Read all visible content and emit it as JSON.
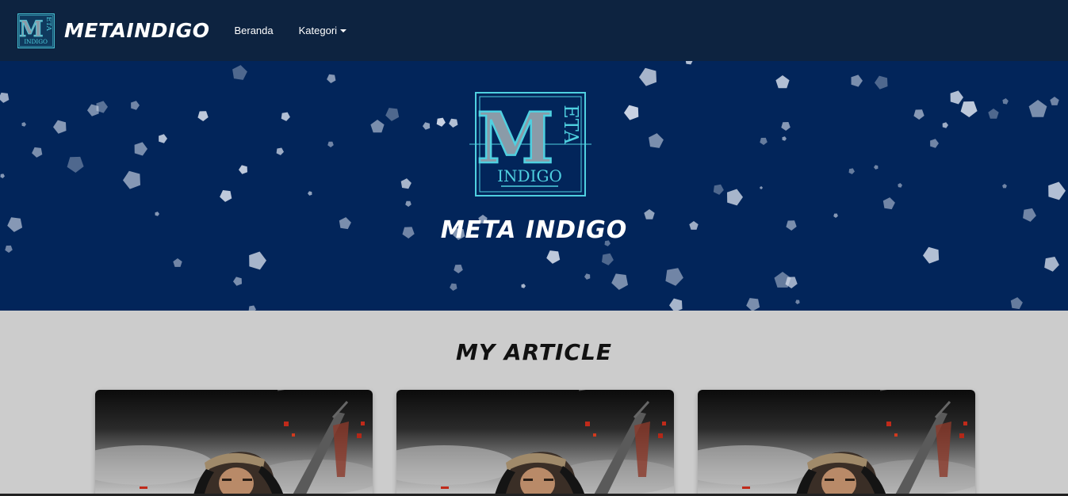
{
  "navbar": {
    "brand": "METAINDIGO",
    "links": [
      {
        "label": "Beranda"
      },
      {
        "label": "Kategori"
      }
    ]
  },
  "logo": {
    "big_letter": "M",
    "side_text": "ETA",
    "bottom_text": "INDIGO",
    "accent": "#4fd0e0"
  },
  "hero": {
    "title": "META INDIGO",
    "background": "#02255a"
  },
  "articles": {
    "title": "MY ARTICLE",
    "cards": [
      {
        "image": "samurai-warrior-artwork"
      },
      {
        "image": "samurai-warrior-artwork"
      },
      {
        "image": "samurai-warrior-artwork"
      }
    ]
  },
  "colors": {
    "navbar_bg": "#0d2340",
    "page_bg": "#cccccc"
  }
}
